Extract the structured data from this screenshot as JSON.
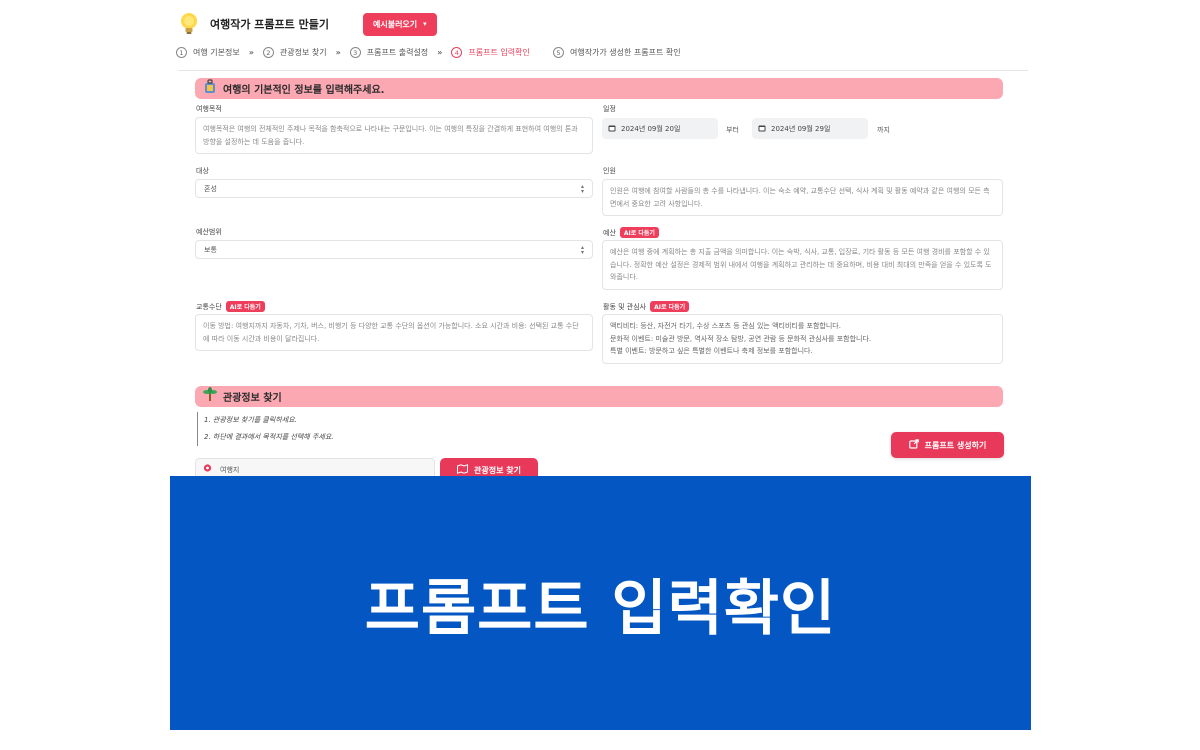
{
  "header": {
    "app_title": "여행작가 프롬프트 만들기",
    "example_button": "예시불러오기"
  },
  "steps": [
    {
      "num": "1",
      "label": "여행 기본정보"
    },
    {
      "num": "2",
      "label": "관광정보 찾기"
    },
    {
      "num": "3",
      "label": "프롬프트 출력설정"
    },
    {
      "num": "4",
      "label": "프롬프트 입력확인"
    },
    {
      "num": "5",
      "label": "여행작가가 생성한 프롬프트 확인"
    }
  ],
  "section_basic": {
    "title": "여행의 기본적인 정보를 입력해주세요."
  },
  "form": {
    "trip_purpose": {
      "label": "여행목적",
      "placeholder": "여행목적은 여행의 전체적인 주제나 목적을 함축적으로 나타내는 구문입니다. 이는 여행의 특징을 간결하게 표현하여 여행의 톤과 방향을 설정하는 데 도움을 줍니다."
    },
    "schedule": {
      "label": "일정",
      "start_date": "2024년 09월 20일",
      "from_text": "부터",
      "end_date": "2024년 09월 29일",
      "to_text": "까지"
    },
    "target": {
      "label": "대상",
      "value": "혼성"
    },
    "people": {
      "label": "인원",
      "placeholder": "인원은 여행에 참여할 사람들의 총 수를 나타냅니다. 이는 숙소 예약, 교통수단 선택, 식사 계획 및 활동 예약과 같은 여행의 모든 측면에서 중요한 고려 사항입니다."
    },
    "budget_level": {
      "label": "예산범위",
      "value": "보통"
    },
    "budget": {
      "label": "예산",
      "badge": "AI로 다듬기",
      "placeholder": "예산은 여행 중에 계획하는 총 지출 금액을 의미합니다. 이는 숙박, 식사, 교통, 입장료, 기타 활동 등 모든 여행 경비를 포함할 수 있습니다. 정확한 예산 설정은 경제적 범위 내에서 여행을 계획하고 관리하는 데 중요하며, 비용 대비 최대의 만족을 얻을 수 있도록 도와줍니다."
    },
    "transport": {
      "label": "교통수단",
      "badge": "AI로 다듬기",
      "placeholder": "이동 방법: 여행지까지 자동차, 기차, 버스, 비행기 등 다양한 교통 수단의 옵션이 가능합니다. 소요 시간과 비용: 선택된 교통 수단에 따라 이동 시간과 비용이 달라집니다."
    },
    "activities": {
      "label": "활동 및 관심사",
      "badge": "AI로 다듬기",
      "line1": "액티비티: 등산, 자전거 타기, 수상 스포츠 등 관심 있는 액티비티를 포함합니다.",
      "line2": "문화적 이벤트: 미술관 방문, 역사적 장소 탐방, 공연 관람 등 문화적 관심사를 포함합니다.",
      "line3": "특별 이벤트: 방문하고 싶은 특별한 이벤트나 축제 정보를 포함합니다."
    }
  },
  "section_tour": {
    "title": "관광정보 찾기",
    "instruction_1": "1. 관광정보 찾기를 클릭하세요.",
    "instruction_2": "2. 하단에 결과에서 목적지를 선택해 주세요.",
    "location_value": "여행지",
    "find_button": "관광정보 찾기",
    "generate_button": "프롬프트 생성하기"
  },
  "banner": {
    "text": "프롬프트 입력확인"
  },
  "colors": {
    "accent": "#e8395a",
    "section_bar": "#fba8b3",
    "banner": "#0456c2"
  }
}
